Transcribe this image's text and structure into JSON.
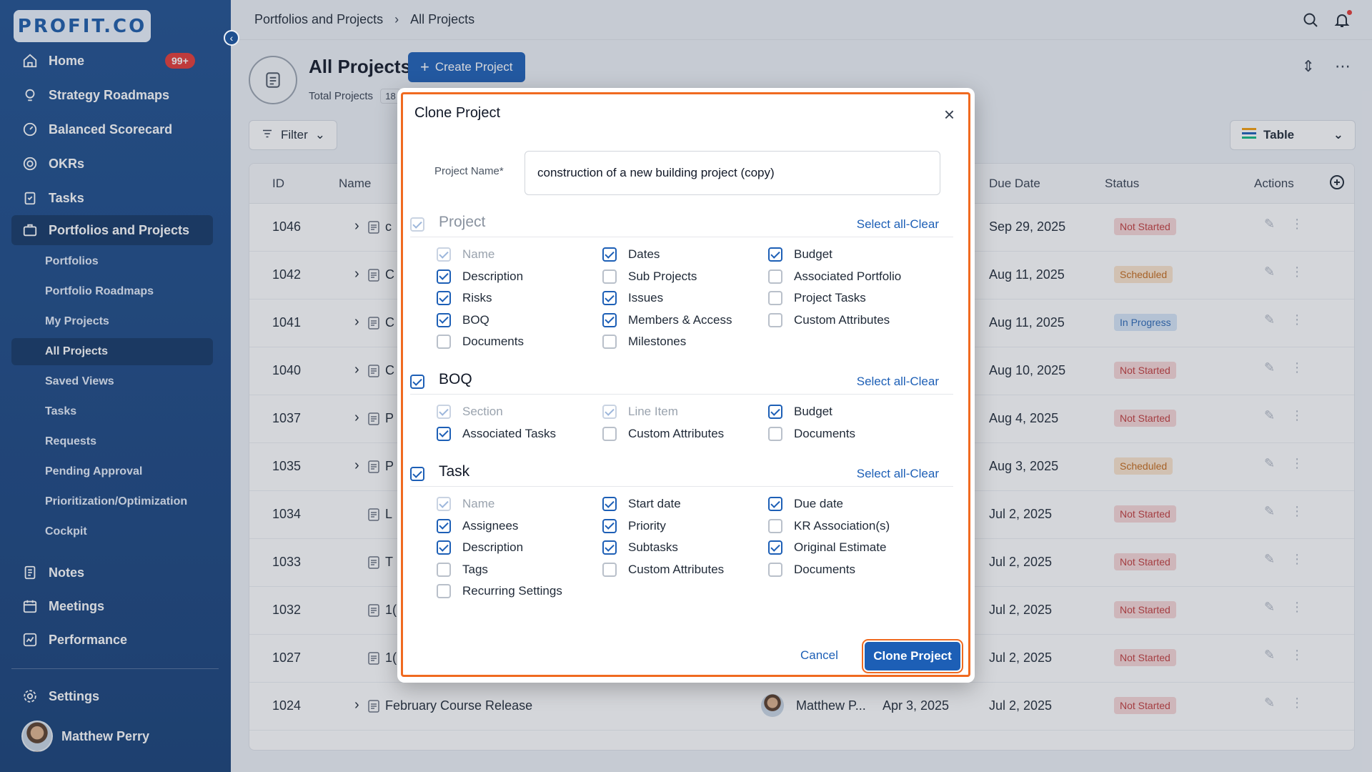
{
  "brand": {
    "logo_text": "PROFIT.CO"
  },
  "sidebar": {
    "home": "Home",
    "home_badge": "99+",
    "strategy": "Strategy Roadmaps",
    "scorecard": "Balanced Scorecard",
    "okrs": "OKRs",
    "tasks": "Tasks",
    "portfolios_projects": "Portfolios and Projects",
    "sub": [
      "Portfolios",
      "Portfolio Roadmaps",
      "My Projects",
      "All Projects",
      "Saved Views",
      "Tasks",
      "Requests",
      "Pending Approval",
      "Prioritization/Optimization",
      "Cockpit"
    ],
    "notes": "Notes",
    "meetings": "Meetings",
    "performance": "Performance",
    "settings": "Settings",
    "user_name": "Matthew Perry"
  },
  "breadcrumb": {
    "parent": "Portfolios and Projects",
    "current": "All Projects"
  },
  "page": {
    "title": "All Projects",
    "create_label": "Create Project",
    "total_label": "Total Projects",
    "total_value": "18",
    "filter_label": "Filter",
    "view_label": "Table"
  },
  "table": {
    "headers": {
      "id": "ID",
      "name": "Name",
      "due": "Due Date",
      "status": "Status",
      "actions": "Actions"
    },
    "rows": [
      {
        "id": "1046",
        "name": "c",
        "due": "Sep 29, 2025",
        "status": "Not Started",
        "kind": "not",
        "expand": true
      },
      {
        "id": "1042",
        "name": "C",
        "due": "Aug 11, 2025",
        "status": "Scheduled",
        "kind": "sch",
        "expand": true
      },
      {
        "id": "1041",
        "name": "C",
        "due": "Aug 11, 2025",
        "status": "In Progress",
        "kind": "prog",
        "expand": true
      },
      {
        "id": "1040",
        "name": "C",
        "due": "Aug 10, 2025",
        "status": "Not Started",
        "kind": "not",
        "expand": true
      },
      {
        "id": "1037",
        "name": "P",
        "due": "Aug 4, 2025",
        "status": "Not Started",
        "kind": "not",
        "expand": true
      },
      {
        "id": "1035",
        "name": "P",
        "due": "Aug 3, 2025",
        "status": "Scheduled",
        "kind": "sch",
        "expand": true
      },
      {
        "id": "1034",
        "name": "L",
        "due": "Jul 2, 2025",
        "status": "Not Started",
        "kind": "not",
        "expand": false
      },
      {
        "id": "1033",
        "name": "T",
        "due": "Jul 2, 2025",
        "status": "Not Started",
        "kind": "not",
        "expand": false
      },
      {
        "id": "1032",
        "name": "1(",
        "due": "Jul 2, 2025",
        "status": "Not Started",
        "kind": "not",
        "expand": false
      },
      {
        "id": "1027",
        "name": "1(",
        "due": "Jul 2, 2025",
        "status": "Not Started",
        "kind": "not",
        "expand": false
      },
      {
        "id": "1024",
        "name": "February Course Release",
        "owner": "Matthew P...",
        "start": "Apr 3, 2025",
        "due": "Jul 2, 2025",
        "status": "Not Started",
        "kind": "not",
        "expand": true
      }
    ]
  },
  "modal": {
    "title": "Clone Project",
    "name_label": "Project Name*",
    "name_value": "construction of a new building project (copy)",
    "select_all": "Select all-Clear",
    "cancel": "Cancel",
    "submit": "Clone Project",
    "sections": {
      "project": {
        "title": "Project",
        "options": [
          {
            "label": "Name",
            "state": "dis"
          },
          {
            "label": "Dates",
            "state": "on"
          },
          {
            "label": "Budget",
            "state": "on"
          },
          {
            "label": "Description",
            "state": "on"
          },
          {
            "label": "Sub Projects",
            "state": "off"
          },
          {
            "label": "Associated Portfolio",
            "state": "off"
          },
          {
            "label": "Risks",
            "state": "on"
          },
          {
            "label": "Issues",
            "state": "on"
          },
          {
            "label": "Project Tasks",
            "state": "off"
          },
          {
            "label": "BOQ",
            "state": "on"
          },
          {
            "label": "Members & Access",
            "state": "on"
          },
          {
            "label": "Custom Attributes",
            "state": "off"
          },
          {
            "label": "Documents",
            "state": "off"
          },
          {
            "label": "Milestones",
            "state": "off"
          }
        ]
      },
      "boq": {
        "title": "BOQ",
        "options": [
          {
            "label": "Section",
            "state": "dis"
          },
          {
            "label": "Line Item",
            "state": "dis"
          },
          {
            "label": "Budget",
            "state": "on"
          },
          {
            "label": "Associated Tasks",
            "state": "on"
          },
          {
            "label": "Custom Attributes",
            "state": "off"
          },
          {
            "label": "Documents",
            "state": "off"
          }
        ]
      },
      "task": {
        "title": "Task",
        "options": [
          {
            "label": "Name",
            "state": "dis"
          },
          {
            "label": "Start date",
            "state": "on"
          },
          {
            "label": "Due date",
            "state": "on"
          },
          {
            "label": "Assignees",
            "state": "on"
          },
          {
            "label": "Priority",
            "state": "on"
          },
          {
            "label": "KR Association(s)",
            "state": "off"
          },
          {
            "label": "Description",
            "state": "on"
          },
          {
            "label": "Subtasks",
            "state": "on"
          },
          {
            "label": "Original Estimate",
            "state": "on"
          },
          {
            "label": "Tags",
            "state": "off"
          },
          {
            "label": "Custom Attributes",
            "state": "off"
          },
          {
            "label": "Documents",
            "state": "off"
          },
          {
            "label": "Recurring Settings",
            "state": "off"
          }
        ]
      }
    }
  },
  "colors": {
    "primary": "#1d5fb6",
    "sidebar": "#1e4f8f",
    "highlight": "#f06a20"
  }
}
